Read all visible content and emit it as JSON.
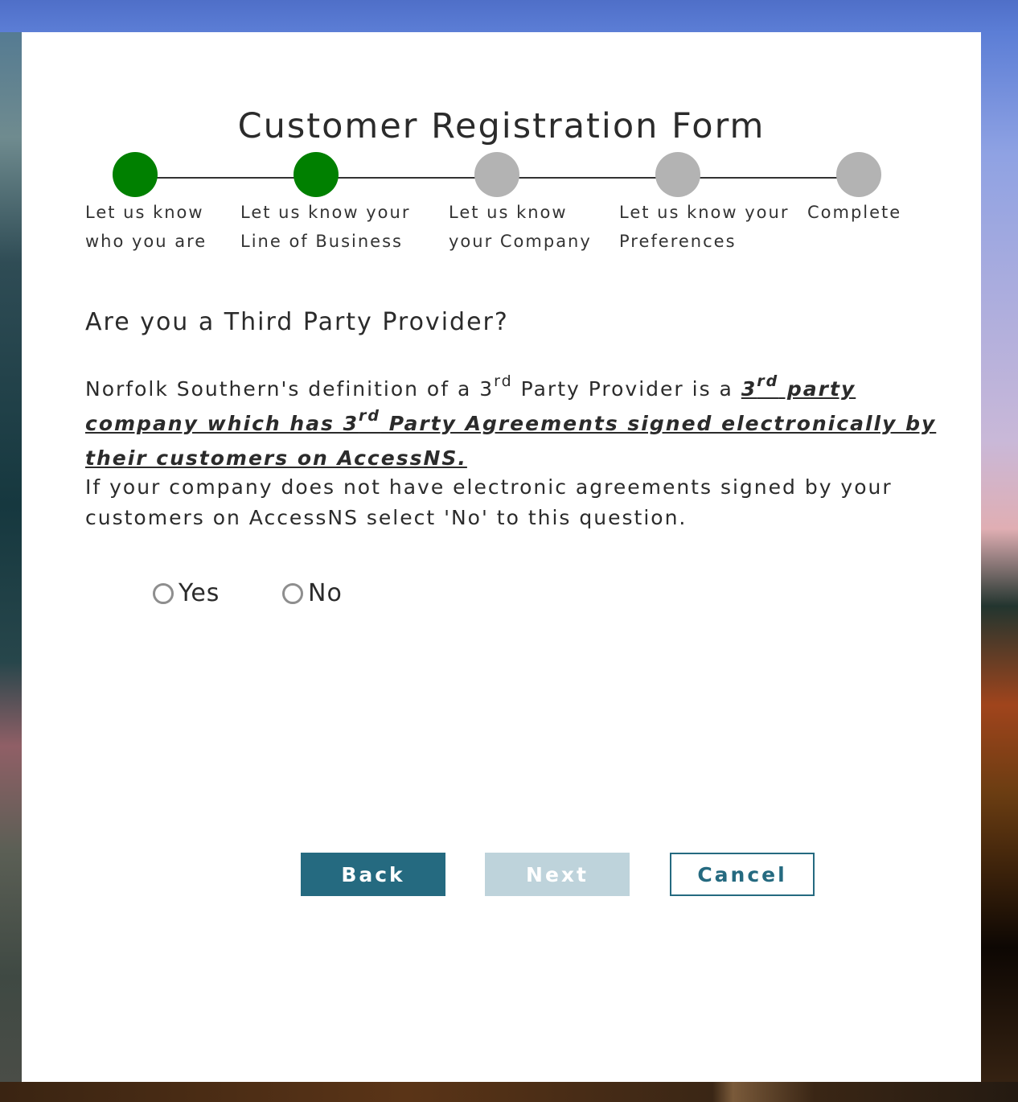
{
  "colors": {
    "step_complete": "#008000",
    "step_pending": "#b3b3b3",
    "primary_button": "#256a80",
    "disabled_button": "#bed3db"
  },
  "form": {
    "title": "Customer Registration Form"
  },
  "steps": [
    {
      "line1": "Let us know",
      "line2": "who you are",
      "status": "complete"
    },
    {
      "line1": "Let us know your",
      "line2": "Line of Business",
      "status": "complete"
    },
    {
      "line1": "Let us know",
      "line2": "your Company",
      "status": "pending"
    },
    {
      "line1": "Let us know your",
      "line2": "Preferences",
      "status": "pending"
    },
    {
      "line1": "Complete",
      "line2": "",
      "status": "pending"
    }
  ],
  "question": {
    "heading": "Are you a Third Party Provider?",
    "definition_intro": "Norfolk Southern's definition of a 3",
    "sup": "rd",
    "definition_mid": " Party Provider is a ",
    "emph_part1": "3",
    "emph_part2": " party company which has 3",
    "emph_part3": " Party Agreements signed electronically by their customers on AccessNS.",
    "followup": "If your company does not have electronic agreements signed by your customers on AccessNS select 'No' to this question."
  },
  "options": {
    "yes": "Yes",
    "no": "No"
  },
  "buttons": {
    "back": "Back",
    "next": "Next",
    "cancel": "Cancel"
  }
}
